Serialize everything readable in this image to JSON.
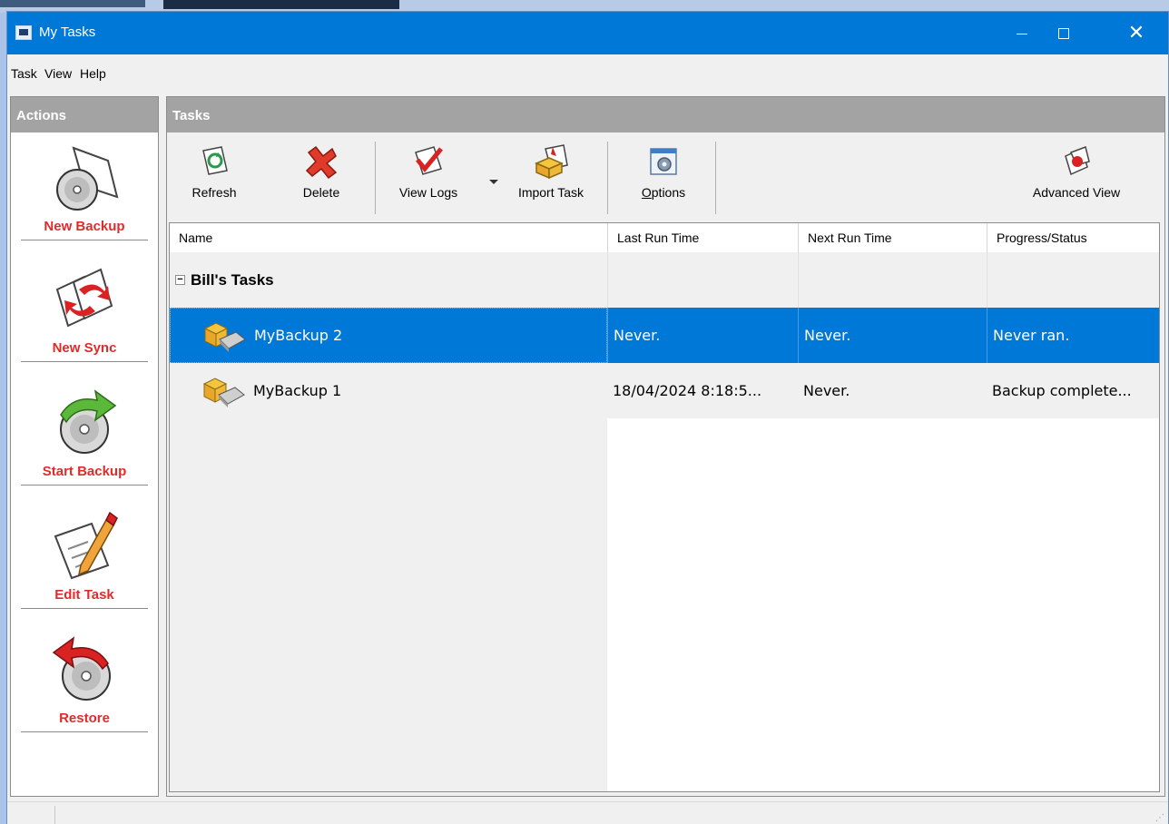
{
  "window": {
    "title": "My Tasks"
  },
  "menu": [
    "Task",
    "View",
    "Help"
  ],
  "actions_panel": {
    "header": "Actions",
    "items": [
      {
        "label": "New Backup",
        "icon": "new-backup-icon"
      },
      {
        "label": "New Sync",
        "icon": "new-sync-icon"
      },
      {
        "label": "Start Backup",
        "icon": "start-backup-icon"
      },
      {
        "label": "Edit Task",
        "icon": "edit-task-icon"
      },
      {
        "label": "Restore",
        "icon": "restore-icon"
      }
    ]
  },
  "tasks_panel": {
    "header": "Tasks",
    "toolbar": {
      "refresh": "Refresh",
      "delete": "Delete",
      "view_logs": "View Logs",
      "import_task": "Import Task",
      "options": "Options",
      "advanced_view": "Advanced View"
    },
    "columns": [
      "Name",
      "Last Run Time",
      "Next Run Time",
      "Progress/Status"
    ],
    "group": {
      "name": "Bill's Tasks",
      "expander": "−"
    },
    "rows": [
      {
        "name": "MyBackup 2",
        "last_run": "Never.",
        "next_run": "Never.",
        "status": "Never ran.",
        "selected": true
      },
      {
        "name": "MyBackup 1",
        "last_run": "18/04/2024 8:18:5...",
        "next_run": "Never.",
        "status": "Backup complete...",
        "selected": false
      }
    ]
  },
  "colors": {
    "titlebar": "#0078d7",
    "action_label": "#e12b2b",
    "selection": "#0078d7",
    "panel_header": "#a3a3a3"
  }
}
